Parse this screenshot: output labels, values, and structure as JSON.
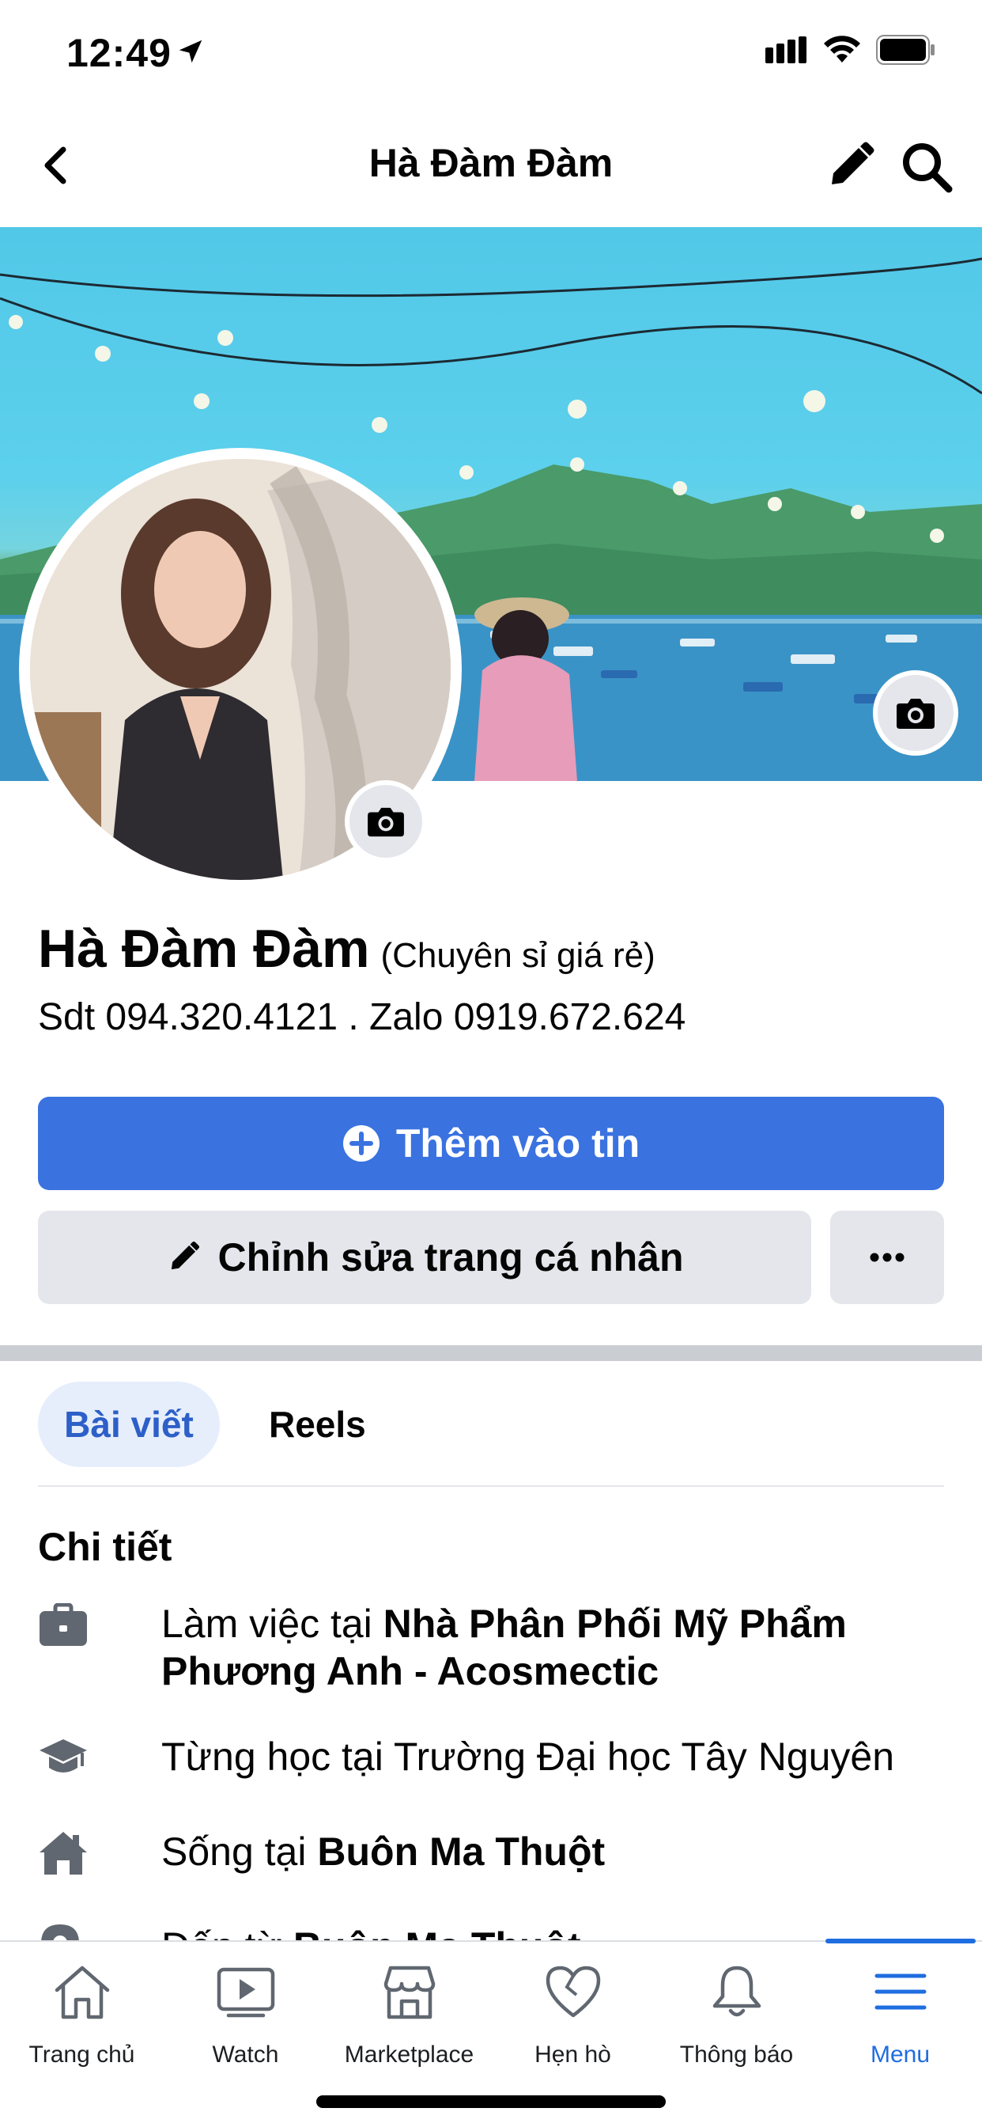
{
  "status_bar": {
    "time": "12:49"
  },
  "header": {
    "title": "Hà Đàm Đàm"
  },
  "profile": {
    "name": "Hà Đàm Đàm",
    "name_suffix": "(Chuyên sỉ giá rẻ)",
    "bio": "Sdt 094.320.4121 . Zalo 0919.672.624"
  },
  "actions": {
    "add_story_label": "Thêm vào tin",
    "edit_profile_label": "Chỉnh sửa trang cá nhân",
    "more_label": "•••"
  },
  "tabs": [
    {
      "label": "Bài viết",
      "active": true
    },
    {
      "label": "Reels",
      "active": false
    }
  ],
  "details": {
    "title": "Chi tiết",
    "items": [
      {
        "icon": "briefcase-icon",
        "prefix": "Làm việc tại ",
        "bold": "Nhà Phân Phối Mỹ Phẩm Phương Anh - Acosmectic"
      },
      {
        "icon": "graduation-cap-icon",
        "prefix": "Từng học tại Trường Đại học Tây Nguyên",
        "bold": ""
      },
      {
        "icon": "house-icon",
        "prefix": "Sống tại ",
        "bold": "Buôn Ma Thuột"
      },
      {
        "icon": "location-pin-icon",
        "prefix": "Đến từ ",
        "bold": "Buôn Ma Thuột"
      }
    ]
  },
  "bottom_nav": [
    {
      "label": "Trang chủ",
      "icon": "home-icon"
    },
    {
      "label": "Watch",
      "icon": "watch-icon"
    },
    {
      "label": "Marketplace",
      "icon": "marketplace-icon"
    },
    {
      "label": "Hẹn hò",
      "icon": "heart-icon"
    },
    {
      "label": "Thông báo",
      "icon": "bell-icon"
    },
    {
      "label": "Menu",
      "icon": "menu-icon",
      "active": true
    }
  ],
  "colors": {
    "primary": "#3a72e0",
    "active_nav": "#1f6de0",
    "secondary_button": "#e4e6eb"
  }
}
